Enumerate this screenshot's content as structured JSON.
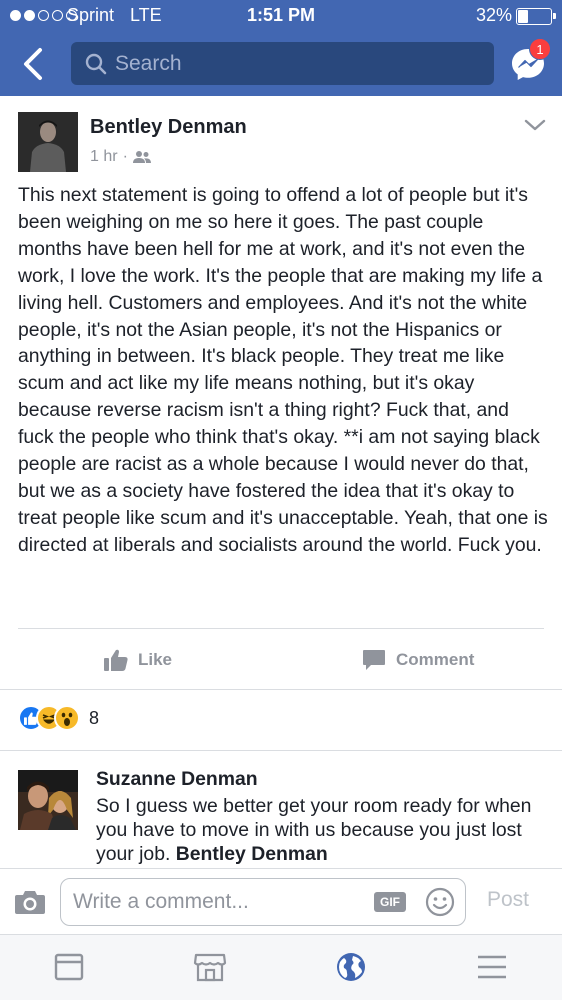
{
  "status_bar": {
    "carrier": "Sprint",
    "network": "LTE",
    "time": "1:51 PM",
    "battery": "32%",
    "battery_level": 0.32,
    "signal_bars": 2
  },
  "header": {
    "search_placeholder": "Search",
    "messenger_badge": "1",
    "accent_color": "#4267b2"
  },
  "post": {
    "author": "Bentley Denman",
    "time": "1 hr",
    "audience_icon": "friends-icon",
    "text": "This next statement is going to offend a lot of people but it's been weighing on me so here it goes. The past couple months have been hell for me at work, and it's not even the work, I love the work. It's the people that are making my life a living hell. Customers and employees. And it's not the white people, it's not the Asian people, it's not the Hispanics or anything in between. It's black people. They treat me like scum and act like my life means nothing, but it's okay because reverse racism isn't a thing right? Fuck that, and fuck the people who think that's okay. **i am not saying black people are racist as a whole because I would never do that, but we as a society have fostered the idea that it's okay to treat people like scum and it's unacceptable. Yeah, that one is directed at liberals and socialists around the world. Fuck you.",
    "actions": {
      "like": "Like",
      "comment": "Comment"
    },
    "reactions": {
      "types": [
        "like",
        "haha",
        "wow"
      ],
      "count": "8"
    }
  },
  "comment": {
    "author": "Suzanne Denman",
    "text": "So I guess we better get your room ready for when you have to move in with us because you just lost your job.",
    "mention": "Bentley Denman"
  },
  "composer": {
    "placeholder": "Write a comment...",
    "gif_label": "GIF",
    "post_label": "Post"
  },
  "tabs": [
    "news-feed",
    "marketplace",
    "notifications-globe",
    "menu"
  ]
}
